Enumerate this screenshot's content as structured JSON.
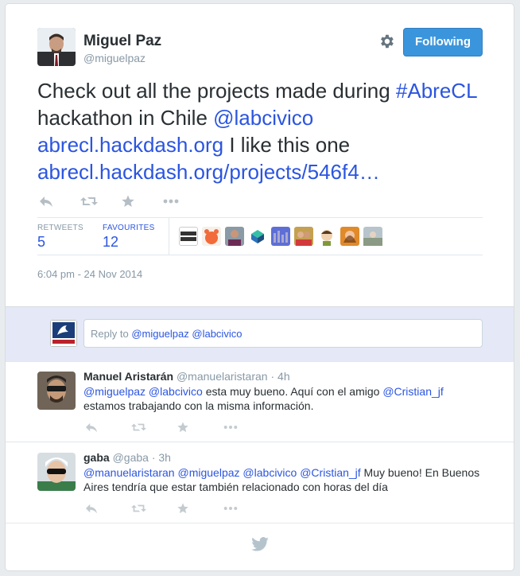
{
  "tweet": {
    "author_name": "Miguel Paz",
    "author_handle": "@miguelpaz",
    "follow_label": "Following",
    "text_parts": {
      "p1": "Check out all the projects made during ",
      "hashtag": "#AbreCL",
      "p2": " hackathon in Chile ",
      "mention": "@labcivico",
      "link1": "abrecl.hackdash.org",
      "p3": " I like this one ",
      "link2": "abrecl.hackdash.org/projects/546f4…"
    },
    "retweets_label": "RETWEETS",
    "retweets_count": "5",
    "favourites_label": "FAVOURITES",
    "favourites_count": "12",
    "timestamp": "6:04 pm - 24 Nov 2014"
  },
  "reply_box": {
    "prefix": "Reply to ",
    "mention1": "@miguelpaz",
    "mention2": "@labcivico"
  },
  "replies": [
    {
      "name": "Manuel Aristarán",
      "handle": "@manuelaristaran",
      "time": "4h",
      "mention1": "@miguelpaz",
      "mention2": "@labcivico",
      "t1": " esta muy bueno. Aquí con el amigo ",
      "mention3": "@Cristian_jf",
      "t2": "estamos trabajando con la misma información."
    },
    {
      "name": "gaba",
      "handle": "@gaba",
      "time": "3h",
      "mention1": "@manuelaristaran",
      "mention2": "@miguelpaz",
      "mention3": "@labcivico",
      "mention4": "@Cristian_jf",
      "t1": " Muy bueno! En Buenos",
      "t2": "Aires tendría que estar también relacionado con horas del día"
    }
  ],
  "favouriter_avatars": [
    "good-sense",
    "orange-creature",
    "person",
    "cube",
    "blue-chart",
    "couple",
    "cartoon",
    "orange-portrait",
    "landscape"
  ],
  "colors": {
    "accent": "#3b95dc",
    "link": "#2b55e0",
    "muted": "#8899a6",
    "reply_bg": "#e4e8f7"
  },
  "icons": [
    "gear-icon",
    "reply-icon",
    "retweet-icon",
    "favorite-icon",
    "more-icon",
    "twitter-bird-icon"
  ]
}
